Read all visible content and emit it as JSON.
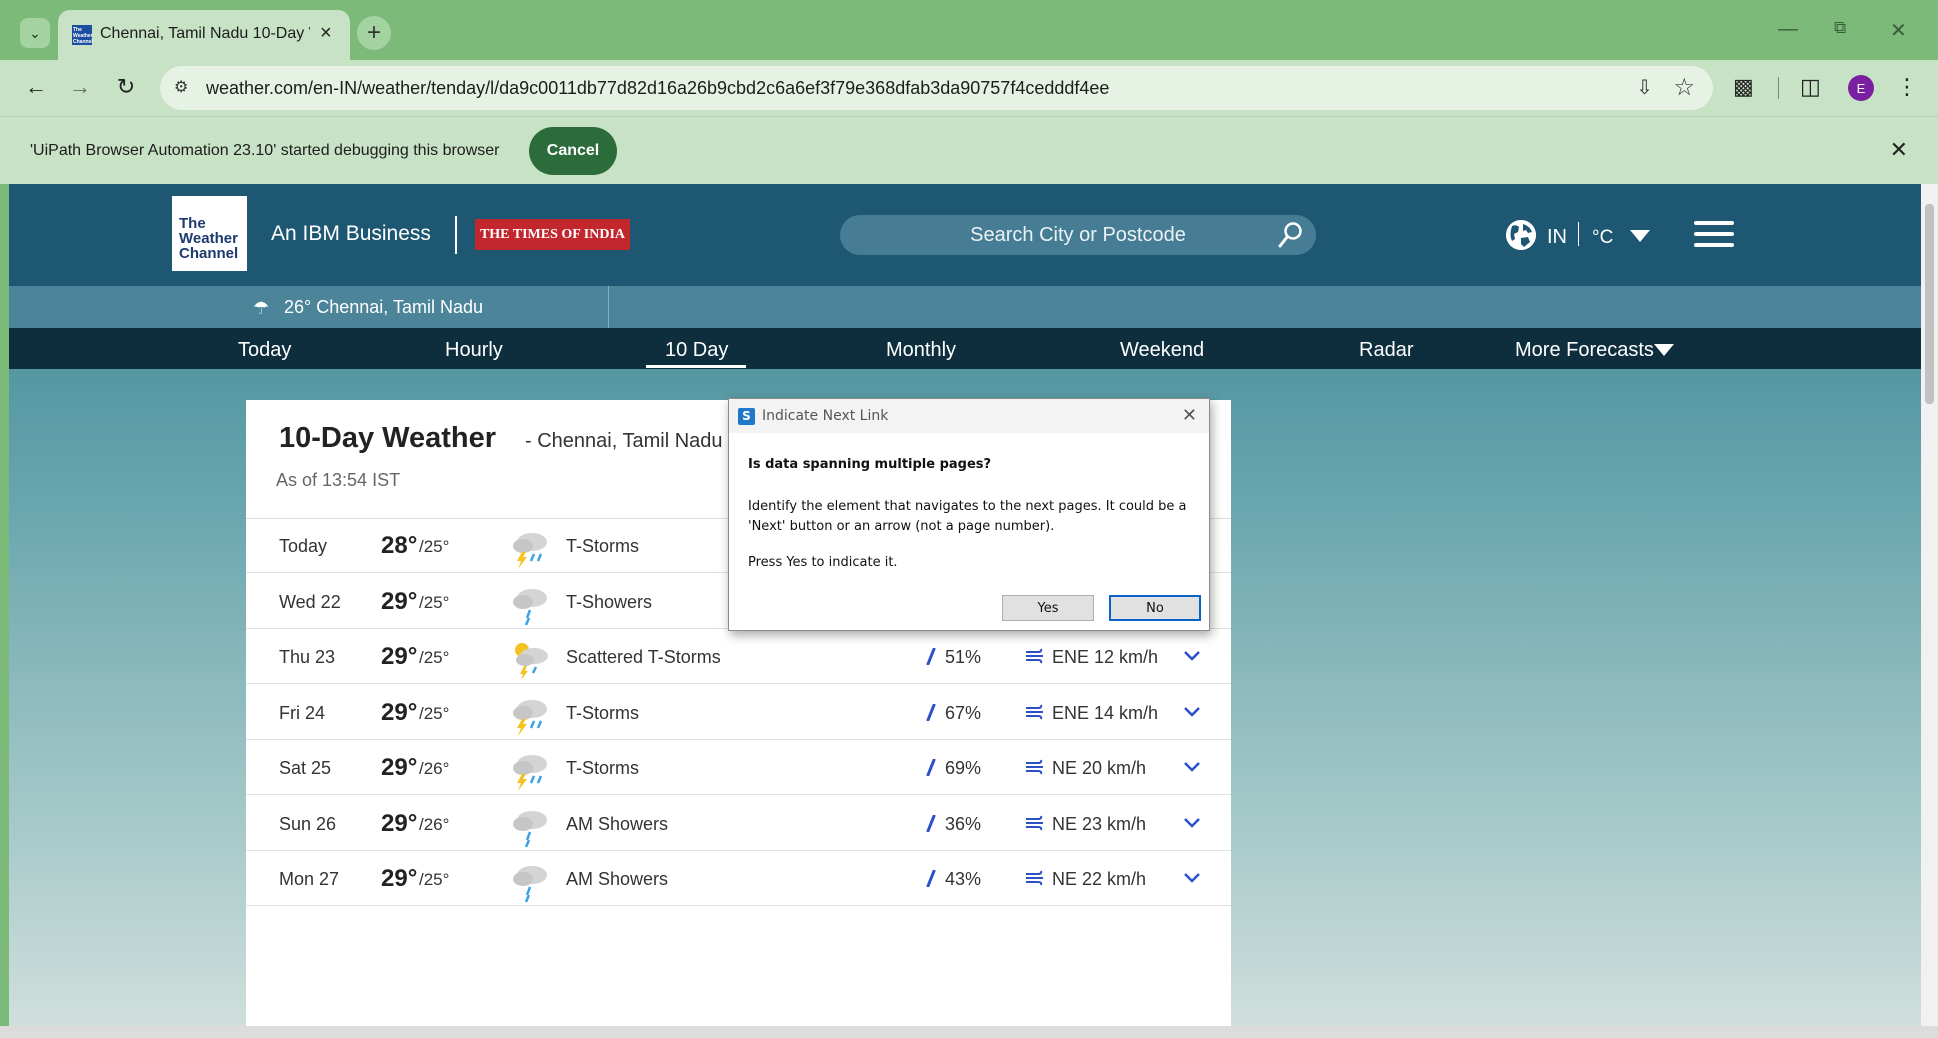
{
  "browser": {
    "tab_title": "Chennai, Tamil Nadu 10-Day W",
    "url": "weather.com/en-IN/weather/tenday/l/da9c0011db77d82d16a26b9cbd2c6a6ef3f79e368dfab3da90757f4cedddf4ee",
    "profile_initial": "E",
    "debug_message": "'UiPath Browser Automation 23.10' started debugging this browser",
    "debug_cancel": "Cancel",
    "favicon_text": "The Weather Channel"
  },
  "site": {
    "logo_text": "The Weather Channel",
    "ibm_label": "An IBM Business",
    "toi_label": "THE TIMES OF INDIA",
    "search_placeholder": "Search City or Postcode",
    "locale": "IN",
    "unit": "°C",
    "current_location": "26° Chennai, Tamil Nadu",
    "nav": [
      "Today",
      "Hourly",
      "10 Day",
      "Monthly",
      "Weekend",
      "Radar",
      "More Forecasts"
    ],
    "active_nav": "10 Day"
  },
  "forecast": {
    "title": "10-Day Weather",
    "subtitle": "- Chennai, Tamil Nadu",
    "as_of": "As of 13:54 IST",
    "rows": [
      {
        "day": "Today",
        "hi": "28°",
        "lo": "/25°",
        "cond": "T-Storms",
        "icon": "thunderstorm-icon",
        "rain": "",
        "wind": ""
      },
      {
        "day": "Wed 22",
        "hi": "29°",
        "lo": "/25°",
        "cond": "T-Showers",
        "icon": "showers-icon",
        "rain": "",
        "wind": ""
      },
      {
        "day": "Thu 23",
        "hi": "29°",
        "lo": "/25°",
        "cond": "Scattered T-Storms",
        "icon": "scattered-thunderstorm-icon",
        "rain": "51%",
        "wind": "ENE 12 km/h"
      },
      {
        "day": "Fri 24",
        "hi": "29°",
        "lo": "/25°",
        "cond": "T-Storms",
        "icon": "thunderstorm-icon",
        "rain": "67%",
        "wind": "ENE 14 km/h"
      },
      {
        "day": "Sat 25",
        "hi": "29°",
        "lo": "/26°",
        "cond": "T-Storms",
        "icon": "thunderstorm-icon",
        "rain": "69%",
        "wind": "NE 20 km/h"
      },
      {
        "day": "Sun 26",
        "hi": "29°",
        "lo": "/26°",
        "cond": "AM Showers",
        "icon": "showers-icon",
        "rain": "36%",
        "wind": "NE 23 km/h"
      },
      {
        "day": "Mon 27",
        "hi": "29°",
        "lo": "/25°",
        "cond": "AM Showers",
        "icon": "showers-icon",
        "rain": "43%",
        "wind": "NE 22 km/h"
      }
    ]
  },
  "dialog": {
    "title": "Indicate Next Link",
    "question": "Is data spanning multiple pages?",
    "body": "Identify the element that navigates to the next pages. It could be a 'Next' button or an arrow (not a page number).",
    "press": "Press Yes to indicate it.",
    "yes": "Yes",
    "no": "No"
  },
  "colors": {
    "browser_frame": "#7cba7a",
    "header": "#1e5772",
    "nav": "#0e2e3e",
    "rain_icon": "#2b50c8"
  }
}
